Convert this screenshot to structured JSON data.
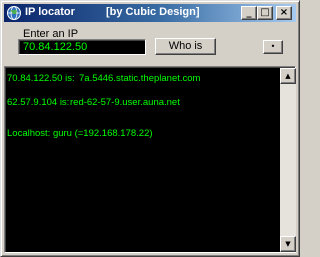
{
  "window": {
    "title": "IP locator",
    "subtitle": "[by Cubic Design]",
    "controls": {
      "minimize": "_",
      "maximize": "□",
      "close": "×"
    }
  },
  "form": {
    "label": "Enter an IP",
    "ip_value": "70.84.122.50",
    "whois_label": "Who is",
    "small_button_label": "•"
  },
  "output": {
    "lines": [
      {
        "key": "70.84.122.50 is:",
        "value": "7a.5446.static.theplanet.com"
      },
      {
        "key": "62.57.9.104 is:",
        "value": "red-62-57-9.user.auna.net"
      },
      {
        "key": "Localhost: guru (=192.168.178.22)"
      }
    ]
  },
  "scrollbar": {
    "up_icon": "▲",
    "down_icon": "▼"
  },
  "colors": {
    "titlebar_start": "#0a246a",
    "titlebar_end": "#a6caf0",
    "text_green": "#00ff00",
    "console_bg": "#000000",
    "chrome": "#d4d0c8"
  },
  "icons": {
    "app": "app-globe-icon",
    "minimize": "minimize-icon",
    "maximize": "maximize-icon",
    "close": "close-icon",
    "scroll_up": "scroll-up-arrow-icon",
    "scroll_down": "scroll-down-arrow-icon"
  }
}
